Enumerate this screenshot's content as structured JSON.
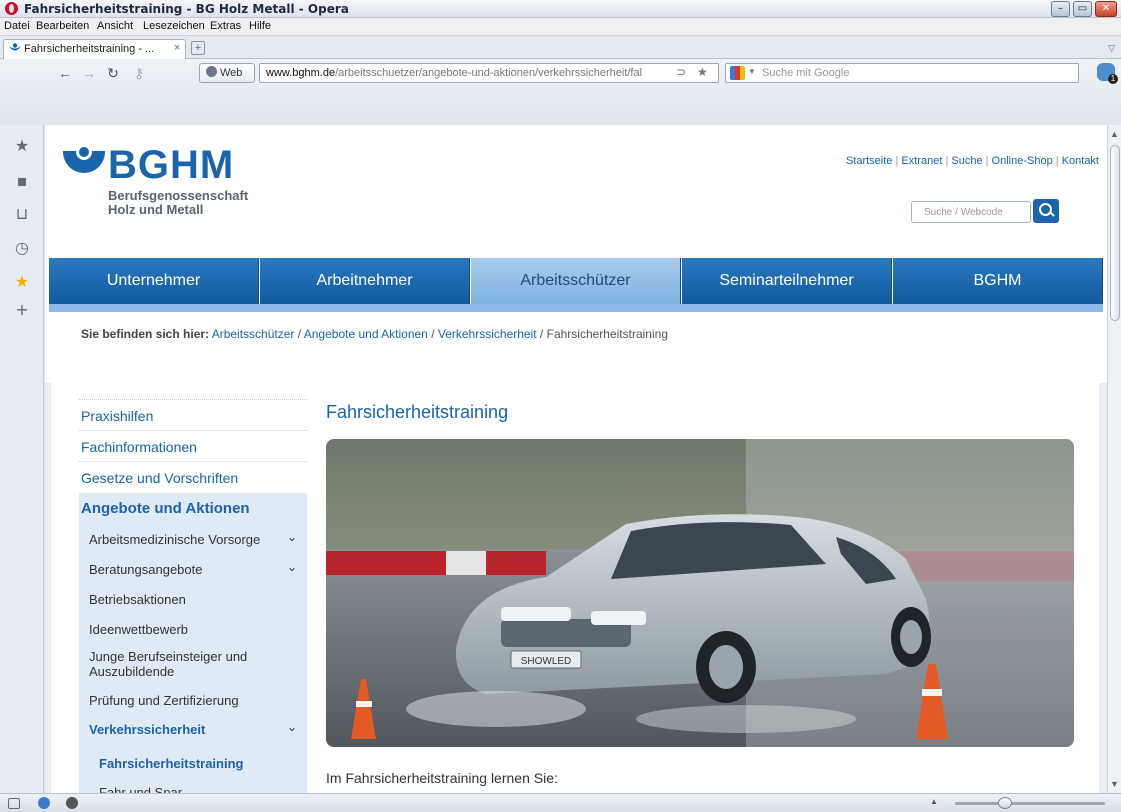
{
  "window": {
    "title": "Fahrsicherheitstraining - BG Holz Metall - Opera",
    "minimize": "–",
    "maximize": "▭",
    "close": "✕"
  },
  "menubar": [
    "Datei",
    "Bearbeiten",
    "Ansicht",
    "Lesezeichen",
    "Extras",
    "Hilfe"
  ],
  "tab": {
    "label": "Fahrsicherheitstraining - ...",
    "close": "×",
    "new_tab": "+"
  },
  "address_bar": {
    "web_label": "Web",
    "url_host": "www.bghm.de",
    "url_path": "/arbeitsschuetzer/angebote-und-aktionen/verkehrssicherheit/fal",
    "search_placeholder": "Suche mit Google"
  },
  "site": {
    "logo_text": "BGHM",
    "logo_sub_line1": "Berufsgenossenschaft",
    "logo_sub_line2": "Holz und Metall",
    "top_links": [
      "Startseite",
      "Extranet",
      "Suche",
      "Online-Shop",
      "Kontakt"
    ],
    "top_links_sep": "|",
    "search_placeholder": "Suche / Webcode",
    "nav": [
      "Unternehmer",
      "Arbeitnehmer",
      "Arbeitsschützer",
      "Seminarteilnehmer",
      "BGHM"
    ],
    "nav_active_index": 2,
    "breadcrumb": {
      "label": "Sie befinden sich hier:",
      "links": [
        "Arbeitsschützer",
        "Angebote und Aktionen",
        "Verkehrssicherheit"
      ],
      "current": "Fahrsicherheitstraining",
      "sep": " / "
    },
    "left_nav": {
      "items": [
        "Praxishilfen",
        "Fachinformationen",
        "Gesetze und Vorschriften"
      ],
      "active_heading": "Angebote und Aktionen",
      "sub_items": [
        "Arbeitsmedizinische Vorsorge",
        "Beratungsangebote",
        "Betriebsaktionen",
        "Ideenwettbewerb",
        "Junge Berufseinsteiger und Auszubildende",
        "Prüfung und Zertifizierung",
        "Verkehrssicherheit"
      ],
      "current_item": "Fahrsicherheitstraining",
      "next_item": "Fahr und Spar"
    },
    "content_title": "Fahrsicherheitstraining",
    "license_plate": "SHOWLED",
    "intro_text": "Im Fahrsicherheitstraining lernen Sie:"
  },
  "colors": {
    "brand_blue": "#1b64ac",
    "nav_active": "#8ebcea",
    "car_body": "#b8c4cc"
  }
}
